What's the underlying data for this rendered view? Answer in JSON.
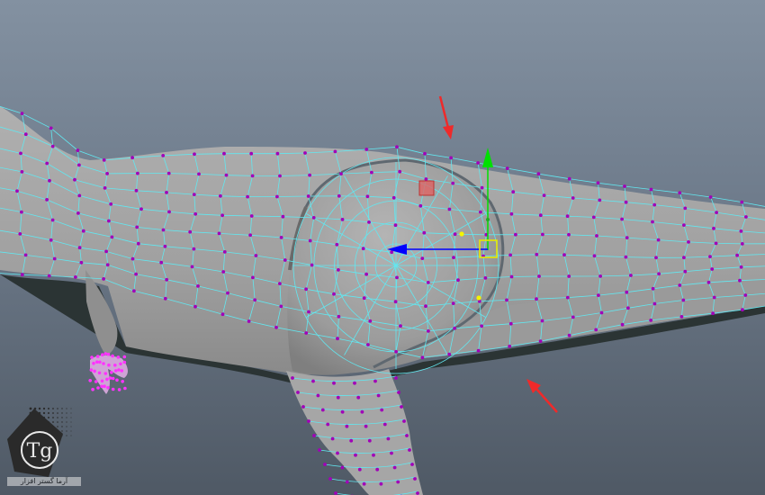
{
  "viewport": {
    "name": "Maya perspective viewport",
    "background_top": "#8391a1",
    "background_bottom": "#4f5965",
    "mesh_fill": "#a2a2a2",
    "wireframe_color": "#62e7f0",
    "vertex_color": "#a100b8",
    "selected_vertex_color": "#ff33ff"
  },
  "manipulator": {
    "tool": "move-tool",
    "y_axis_color": "#00e000",
    "z_axis_color": "#0000ff",
    "x_handle_color": "#e35d5d",
    "center_handle_color": "#e8e800",
    "soft_selection_dot_color": "#f4f400"
  },
  "annotations": {
    "arrow_color": "#ef2a2a",
    "arrows": [
      "arrow-pointing-to-back-edge",
      "arrow-pointing-to-belly-edge"
    ]
  },
  "watermark": {
    "caption": "آرما گستر افزار",
    "logo_text": "Tg"
  }
}
